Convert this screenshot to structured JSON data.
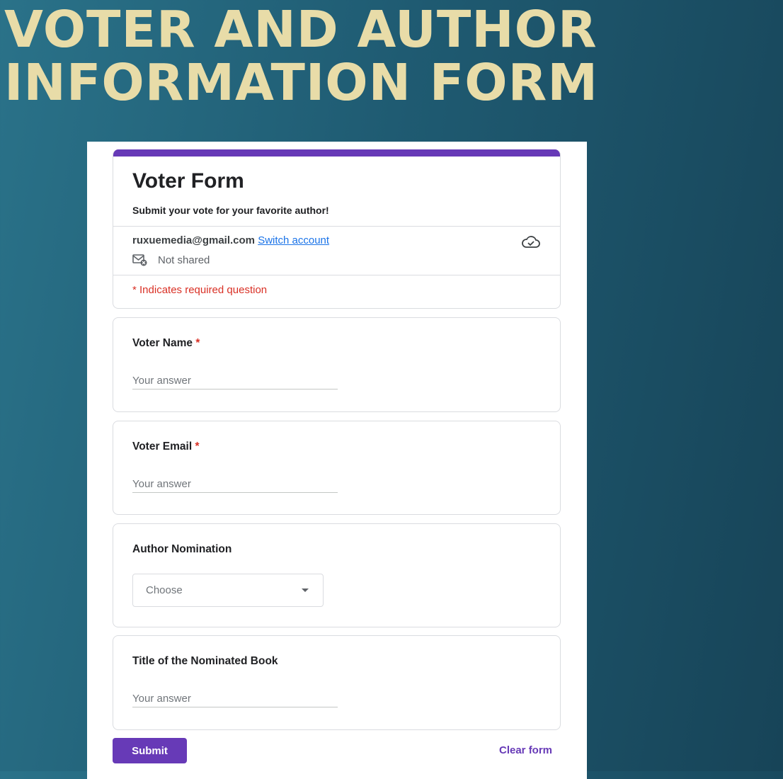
{
  "banner": {
    "title_line1": "VOTER AND AUTHOR",
    "title_line2": "INFORMATION FORM"
  },
  "form": {
    "title": "Voter Form",
    "description": "Submit your vote for your favorite author!",
    "account_email": "ruxuemedia@gmail.com",
    "switch_account_label": "Switch account",
    "not_shared_label": "Not shared",
    "required_note": "* Indicates required question",
    "accent_color": "#673ab7"
  },
  "questions": [
    {
      "label": "Voter Name",
      "required_mark": "*",
      "placeholder": "Your answer"
    },
    {
      "label": "Voter Email",
      "required_mark": "*",
      "placeholder": "Your answer"
    },
    {
      "label": "Author Nomination",
      "dropdown_value": "Choose"
    },
    {
      "label": "Title of the Nominated Book",
      "placeholder": "Your answer"
    }
  ],
  "actions": {
    "submit_label": "Submit",
    "clear_label": "Clear form"
  },
  "icons": {
    "cloud": "cloud-saved-icon",
    "mail": "mail-not-shared-icon",
    "caret": "dropdown-caret-icon"
  }
}
